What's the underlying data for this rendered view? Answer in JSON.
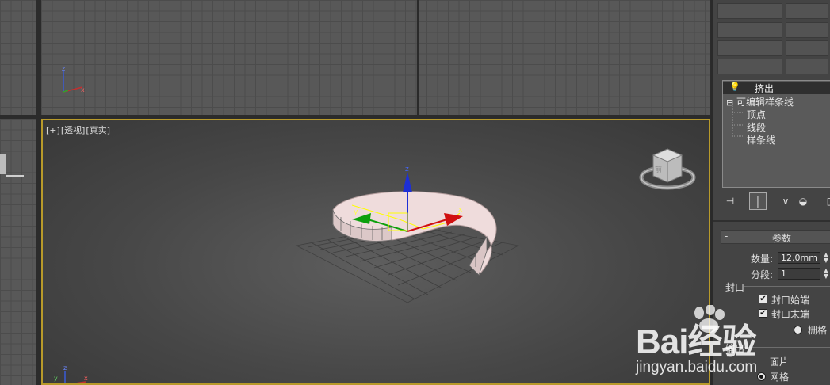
{
  "viewport": {
    "labels": [
      "[+]",
      "[透视]",
      "[真实]"
    ],
    "axes": {
      "x": "x",
      "y": "y",
      "z": "z"
    },
    "gizmo_axes": {
      "x": "x",
      "y": "y",
      "z": "z"
    },
    "viewcube_label": "前",
    "active_border_color": "#b89a2a"
  },
  "modifier_stack": {
    "items": [
      {
        "label": "挤出",
        "icon": "bulb-icon"
      },
      {
        "label": "可编辑样条线",
        "expander": "⊟"
      },
      {
        "label": "顶点"
      },
      {
        "label": "线段"
      },
      {
        "label": "样条线"
      }
    ]
  },
  "toolbar": {
    "icons": [
      "pin-stack-icon",
      "show-end-result-icon",
      "make-unique-icon",
      "remove-modifier-icon",
      "configure-sets-icon"
    ]
  },
  "parameters": {
    "rollout_toggle": "-",
    "title": "参数",
    "amount_label": "数量:",
    "amount_value": "12.0mm",
    "segments_label": "分段:",
    "segments_value": "1",
    "capping_label": "封口",
    "cap_start_label": "封口始端",
    "cap_end_label": "封口末端",
    "grid_label": "栅格",
    "output_label": "输出",
    "patch_label": "面片",
    "mesh_label": "网格"
  },
  "watermark": {
    "brand_text": "Bai经验",
    "url": "jingyan.baidu.com"
  }
}
